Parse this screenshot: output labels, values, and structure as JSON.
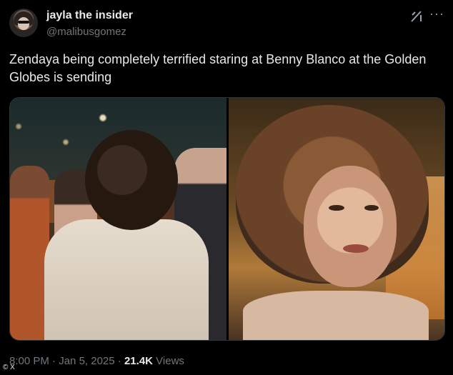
{
  "author": {
    "display_name": "jayla the insider",
    "handle": "@malibusgomez"
  },
  "header_icons": {
    "grok": "grok-icon",
    "more": "more-icon",
    "more_glyph": "···"
  },
  "tweet": {
    "text": "Zendaya being completely terrified staring at Benny Blanco at the Golden Globes is sending"
  },
  "meta": {
    "time": "8:00 PM",
    "separator": " · ",
    "date": "Jan 5, 2025",
    "views_count": "21.4K",
    "views_label": " Views"
  },
  "watermark": {
    "text": "© X"
  },
  "colors": {
    "background": "#000000",
    "primary_text": "#e7e9ea",
    "secondary_text": "#71767b",
    "border": "#2f3336"
  }
}
